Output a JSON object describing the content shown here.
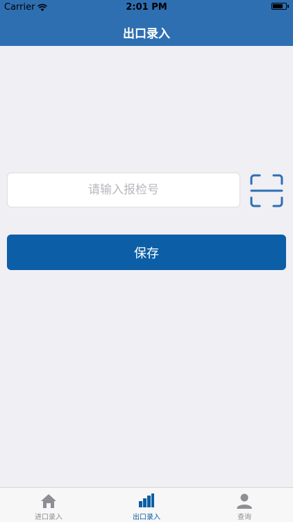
{
  "status_bar": {
    "carrier": "Carrier",
    "time": "2:01 PM"
  },
  "nav": {
    "title": "出口录入"
  },
  "form": {
    "input_value": "",
    "input_placeholder": "请输入报检号",
    "scan_icon": "scan-frame-icon",
    "save_label": "保存"
  },
  "tabs": [
    {
      "label": "进口录入",
      "icon": "home-icon",
      "active": false
    },
    {
      "label": "出口录入",
      "icon": "bar-chart-icon",
      "active": true
    },
    {
      "label": "查询",
      "icon": "person-icon",
      "active": false
    }
  ],
  "colors": {
    "accent": "#0c5ea6",
    "nav_bg": "#2e6fb2",
    "page_bg": "#efeff4"
  }
}
